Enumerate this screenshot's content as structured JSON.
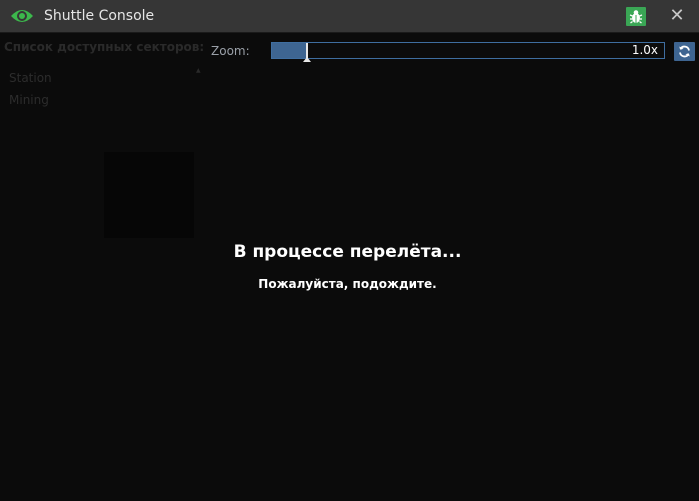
{
  "window": {
    "title": "Shuttle Console",
    "close_label": "✕"
  },
  "sidebar": {
    "title": "Список доступных секторов:",
    "sectors": [
      {
        "label": "Station"
      },
      {
        "label": "Mining"
      }
    ]
  },
  "toolbar": {
    "zoom_label": "Zoom:",
    "zoom_value": "1.0x",
    "zoom_level_fraction": 0.09
  },
  "overlay": {
    "title": "В процессе перелёта...",
    "subtitle": "Пожалуйста, подождите."
  },
  "colors": {
    "titlebar": "#363636",
    "background": "#0b0b0b",
    "eye_icon": "#3cb84c",
    "bug_button": "#3aa655",
    "accent_blue": "#3e6591"
  }
}
